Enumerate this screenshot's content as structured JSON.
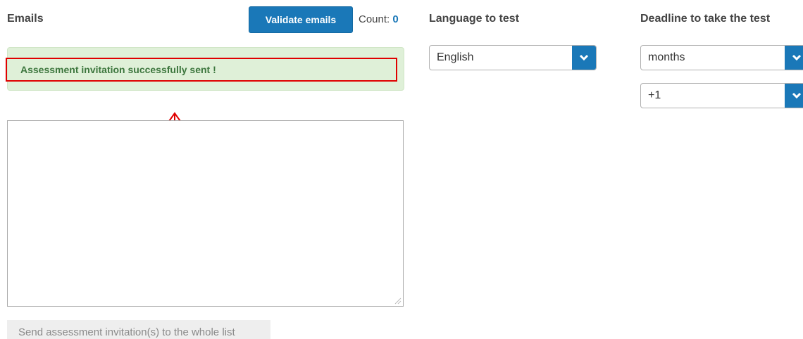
{
  "emails": {
    "label": "Emails",
    "validate_button": "Validate emails",
    "count_label": "Count:",
    "count_value": "0",
    "textarea_value": "",
    "send_button": "Send assessment invitation(s) to the whole list"
  },
  "alert": {
    "message": "Assessment invitation successfully sent !"
  },
  "language": {
    "label": "Language to test",
    "selected": "English"
  },
  "deadline": {
    "label": "Deadline to take the test",
    "unit_selected": "months",
    "amount_selected": "+1"
  },
  "colors": {
    "accent": "#1a78b8",
    "success_bg": "#dff0d8",
    "success_text": "#3c763d",
    "annotation": "#e00000"
  },
  "icons": {
    "dropdown": "chevron-down-icon",
    "annotation": "up-arrow-icon",
    "resize": "resize-grip-icon"
  }
}
